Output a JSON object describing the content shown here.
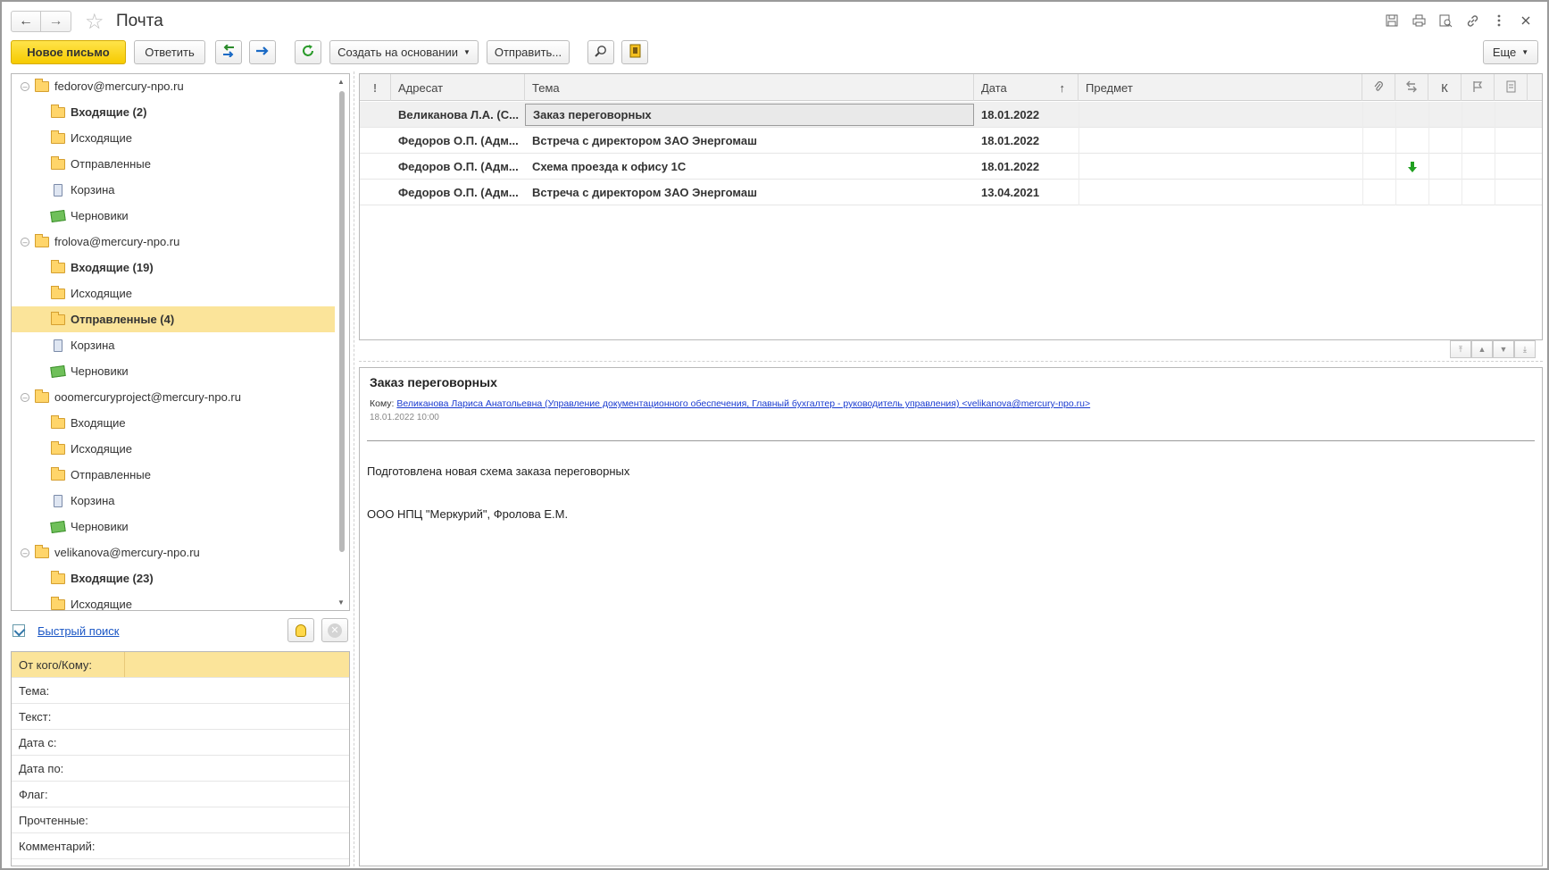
{
  "window": {
    "title": "Почта",
    "back_icon": "←",
    "forward_icon": "→",
    "star_icon": "☆"
  },
  "toolbar": {
    "new_letter": "Новое письмо",
    "reply": "Ответить",
    "create_based_on": "Создать на основании",
    "send": "Отправить...",
    "more": "Еще"
  },
  "tree": [
    {
      "label": "fedorov@mercury-npo.ru",
      "type": "account",
      "bold": false
    },
    {
      "label": "Входящие (2)",
      "type": "folder",
      "bold": true
    },
    {
      "label": "Исходящие",
      "type": "folder",
      "bold": false
    },
    {
      "label": "Отправленные",
      "type": "folder",
      "bold": false
    },
    {
      "label": "Корзина",
      "type": "trash",
      "bold": false
    },
    {
      "label": "Черновики",
      "type": "drafts",
      "bold": false
    },
    {
      "label": "frolova@mercury-npo.ru",
      "type": "account",
      "bold": false
    },
    {
      "label": "Входящие (19)",
      "type": "folder",
      "bold": true
    },
    {
      "label": "Исходящие",
      "type": "folder",
      "bold": false
    },
    {
      "label": "Отправленные (4)",
      "type": "folder",
      "bold": true,
      "selected": true
    },
    {
      "label": "Корзина",
      "type": "trash",
      "bold": false
    },
    {
      "label": "Черновики",
      "type": "drafts",
      "bold": false
    },
    {
      "label": "ooomercuryproject@mercury-npo.ru",
      "type": "account",
      "bold": false
    },
    {
      "label": "Входящие",
      "type": "folder",
      "bold": false
    },
    {
      "label": "Исходящие",
      "type": "folder",
      "bold": false
    },
    {
      "label": "Отправленные",
      "type": "folder",
      "bold": false
    },
    {
      "label": "Корзина",
      "type": "trash",
      "bold": false
    },
    {
      "label": "Черновики",
      "type": "drafts",
      "bold": false
    },
    {
      "label": "velikanova@mercury-npo.ru",
      "type": "account",
      "bold": false
    },
    {
      "label": "Входящие (23)",
      "type": "folder",
      "bold": true
    },
    {
      "label": "Исходящие",
      "type": "folder",
      "bold": false
    }
  ],
  "quick_search": {
    "label": "Быстрый поиск"
  },
  "filters": [
    "От кого/Кому:",
    "Тема:",
    "Текст:",
    "Дата с:",
    "Дата по:",
    "Флаг:",
    "Прочтенные:",
    "Комментарий:"
  ],
  "grid": {
    "headers": {
      "importance": "!",
      "addressee": "Адресат",
      "subject": "Тема",
      "date": "Дата",
      "sort_icon": "↑",
      "item": "Предмет",
      "category": "К"
    },
    "rows": [
      {
        "addressee": "Великанова Л.А. (С...",
        "subject": "Заказ переговорных",
        "date": "18.01.2022",
        "arrow": false
      },
      {
        "addressee": "Федоров О.П. (Адм...",
        "subject": "Встреча с директором ЗАО Энергомаш",
        "date": "18.01.2022",
        "arrow": false
      },
      {
        "addressee": "Федоров О.П. (Адм...",
        "subject": "Схема проезда к офису 1С",
        "date": "18.01.2022",
        "arrow": true
      },
      {
        "addressee": "Федоров О.П. (Адм...",
        "subject": "Встреча с директором ЗАО Энергомаш",
        "date": "13.04.2021",
        "arrow": false
      }
    ]
  },
  "preview": {
    "subject": "Заказ переговорных",
    "to_label": "Кому:",
    "to_value": "Великанова Лариса Анатольевна (Управление документационного обеспечения, Главный бухгалтер - руководитель управления) <velikanova@mercury-npo.ru>",
    "datetime": "18.01.2022 10:00",
    "body_line1": "Подготовлена новая схема заказа переговорных",
    "body_line2": "ООО НПЦ \"Меркурий\", Фролова Е.М."
  },
  "colors": {
    "primary_button": "#f6cb00",
    "selection": "#fbe49a",
    "link": "#1a56c5"
  }
}
